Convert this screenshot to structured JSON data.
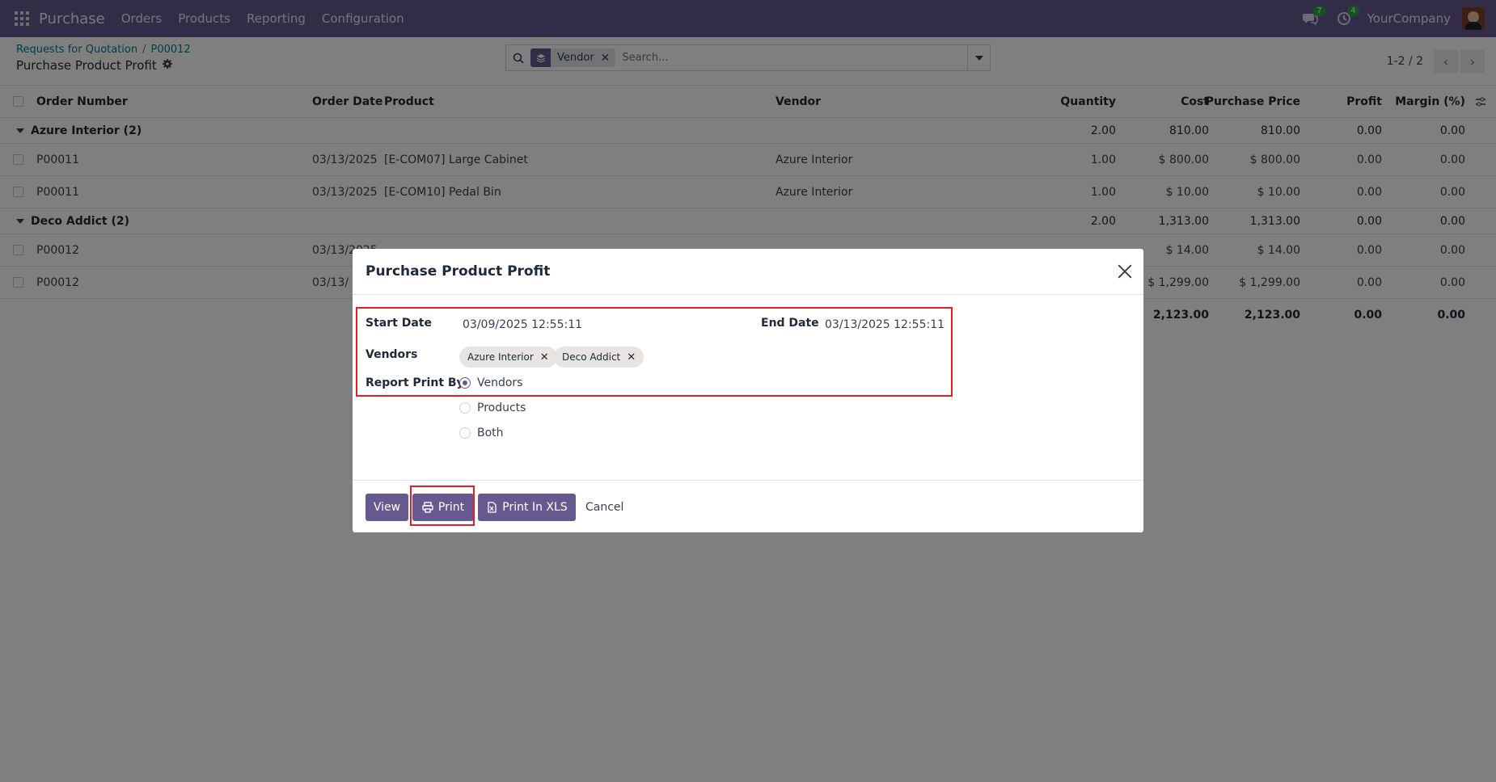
{
  "navbar": {
    "app_name": "Purchase",
    "menu": [
      "Orders",
      "Products",
      "Reporting",
      "Configuration"
    ],
    "messages_badge": "7",
    "activities_badge": "4",
    "company": "YourCompany",
    "color": "#66598f"
  },
  "control": {
    "breadcrumb": [
      "Requests for Quotation",
      "P00012"
    ],
    "title": "Purchase Product Profit",
    "facet_label": "Vendor",
    "search_placeholder": "Search...",
    "pager": "1-2 / 2"
  },
  "table": {
    "columns": [
      "Order Number",
      "Order Date",
      "Product",
      "Vendor",
      "Quantity",
      "Cost",
      "Purchase Price",
      "Profit",
      "Margin (%)"
    ],
    "groups": [
      {
        "name": "Azure Interior (2)",
        "quantity": "2.00",
        "cost": "810.00",
        "price": "810.00",
        "profit": "0.00",
        "margin": "0.00",
        "rows": [
          {
            "order": "P00011",
            "date": "03/13/2025",
            "product": "[E-COM07] Large Cabinet",
            "vendor": "Azure Interior",
            "quantity": "1.00",
            "cost": "$ 800.00",
            "price": "$ 800.00",
            "profit": "0.00",
            "margin": "0.00"
          },
          {
            "order": "P00011",
            "date": "03/13/2025",
            "product": "[E-COM10] Pedal Bin",
            "vendor": "Azure Interior",
            "quantity": "1.00",
            "cost": "$ 10.00",
            "price": "$ 10.00",
            "profit": "0.00",
            "margin": "0.00"
          }
        ]
      },
      {
        "name": "Deco Addict (2)",
        "quantity": "2.00",
        "cost": "1,313.00",
        "price": "1,313.00",
        "profit": "0.00",
        "margin": "0.00",
        "rows": [
          {
            "order": "P00012",
            "date": "03/13/2025",
            "product": "",
            "vendor": "",
            "quantity": "",
            "cost": "$ 14.00",
            "price": "$ 14.00",
            "profit": "0.00",
            "margin": "0.00"
          },
          {
            "order": "P00012",
            "date": "03/13/",
            "product": "",
            "vendor": "",
            "quantity": "",
            "cost": "$ 1,299.00",
            "price": "$ 1,299.00",
            "profit": "0.00",
            "margin": "0.00"
          }
        ]
      }
    ],
    "totals": {
      "cost": "2,123.00",
      "price": "2,123.00",
      "profit": "0.00",
      "margin": "0.00"
    }
  },
  "dialog": {
    "title": "Purchase Product Profit",
    "start_date_label": "Start Date",
    "start_date": "03/09/2025 12:55:11",
    "end_date_label": "End Date",
    "end_date": "03/13/2025 12:55:11",
    "vendors_label": "Vendors",
    "vendors": [
      "Azure Interior",
      "Deco Addict"
    ],
    "print_by_label": "Report Print By",
    "print_by_options": [
      "Vendors",
      "Products",
      "Both"
    ],
    "print_by_selected": "Vendors",
    "buttons": {
      "view": "View",
      "print": "Print",
      "print_xls": "Print In XLS",
      "cancel": "Cancel"
    },
    "highlight_color": "#e31e25"
  }
}
